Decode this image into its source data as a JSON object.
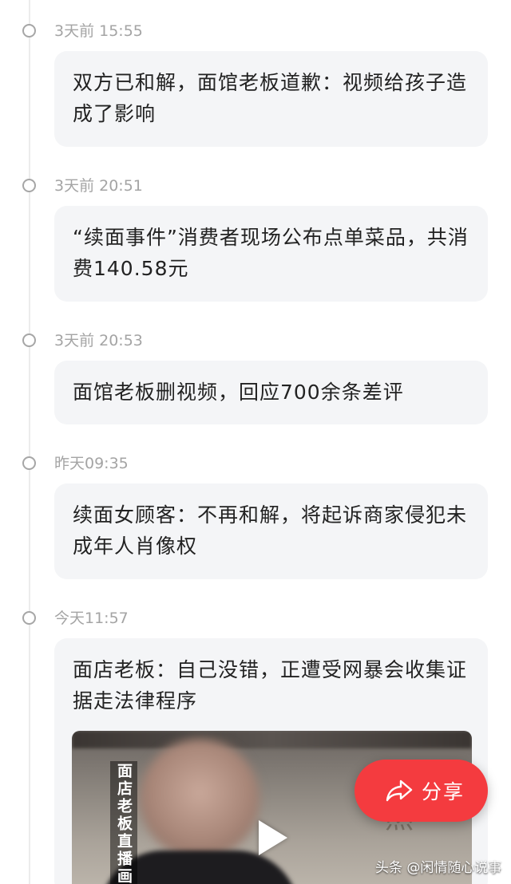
{
  "timeline": [
    {
      "time": "3天前 15:55",
      "title": "双方已和解，面馆老板道歉：视频给孩子造成了影响"
    },
    {
      "time": "3天前 20:51",
      "title": "“续面事件”消费者现场公布点单菜品，共消费140.58元"
    },
    {
      "time": "3天前 20:53",
      "title": "面馆老板删视频，回应700余条差评"
    },
    {
      "time": "昨天09:35",
      "title": "续面女顾客：不再和解，将起诉商家侵犯未成年人肖像权"
    },
    {
      "time": "今天11:57",
      "title": "面店老板：自己没错，正遭受网暴会收集证据走法律程序"
    }
  ],
  "video": {
    "caption": "面店老板直播画",
    "deco_text": "然",
    "play_icon": "play-icon"
  },
  "share_button": {
    "label": "分享",
    "icon": "share-arrow-icon",
    "color": "#f43b3f"
  },
  "watermark": "头条 @闲情随心说事"
}
